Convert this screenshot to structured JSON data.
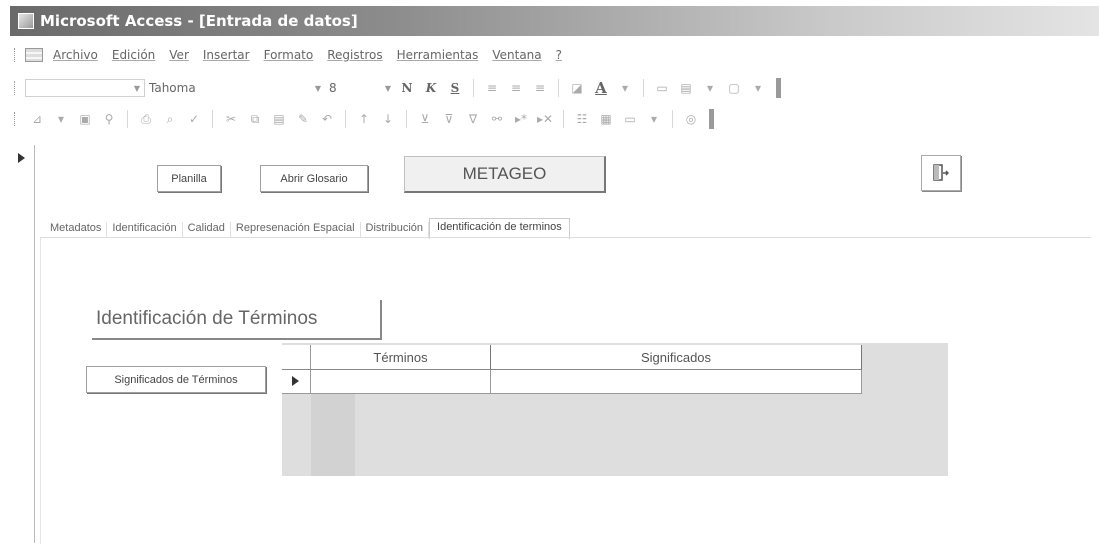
{
  "window": {
    "title": "Microsoft Access - [Entrada de datos]"
  },
  "menu": {
    "items": [
      "Archivo",
      "Edición",
      "Ver",
      "Insertar",
      "Formato",
      "Registros",
      "Herramientas",
      "Ventana",
      "?"
    ]
  },
  "format_toolbar": {
    "font_name": "Tahoma",
    "font_size": "8",
    "bold_label": "N",
    "italic_label": "K",
    "underline_label": "S",
    "font_color_label": "A"
  },
  "form": {
    "planilla_button": "Planilla",
    "glosario_button": "Abrir Glosario",
    "metageo_label": "METAGEO",
    "tabs": [
      {
        "label": "Metadatos"
      },
      {
        "label": "Identificación"
      },
      {
        "label": "Calidad"
      },
      {
        "label": "Represenación Espacial"
      },
      {
        "label": "Distribución"
      },
      {
        "label": "Identificación de terminos"
      }
    ],
    "section_title": "Identificación de Términos",
    "significados_button": "Significados de Términos",
    "grid": {
      "columns": [
        "Términos",
        "Significados"
      ]
    }
  },
  "icons": {
    "exit": "exit-door-icon",
    "record_selector": "record-pointer-icon"
  }
}
